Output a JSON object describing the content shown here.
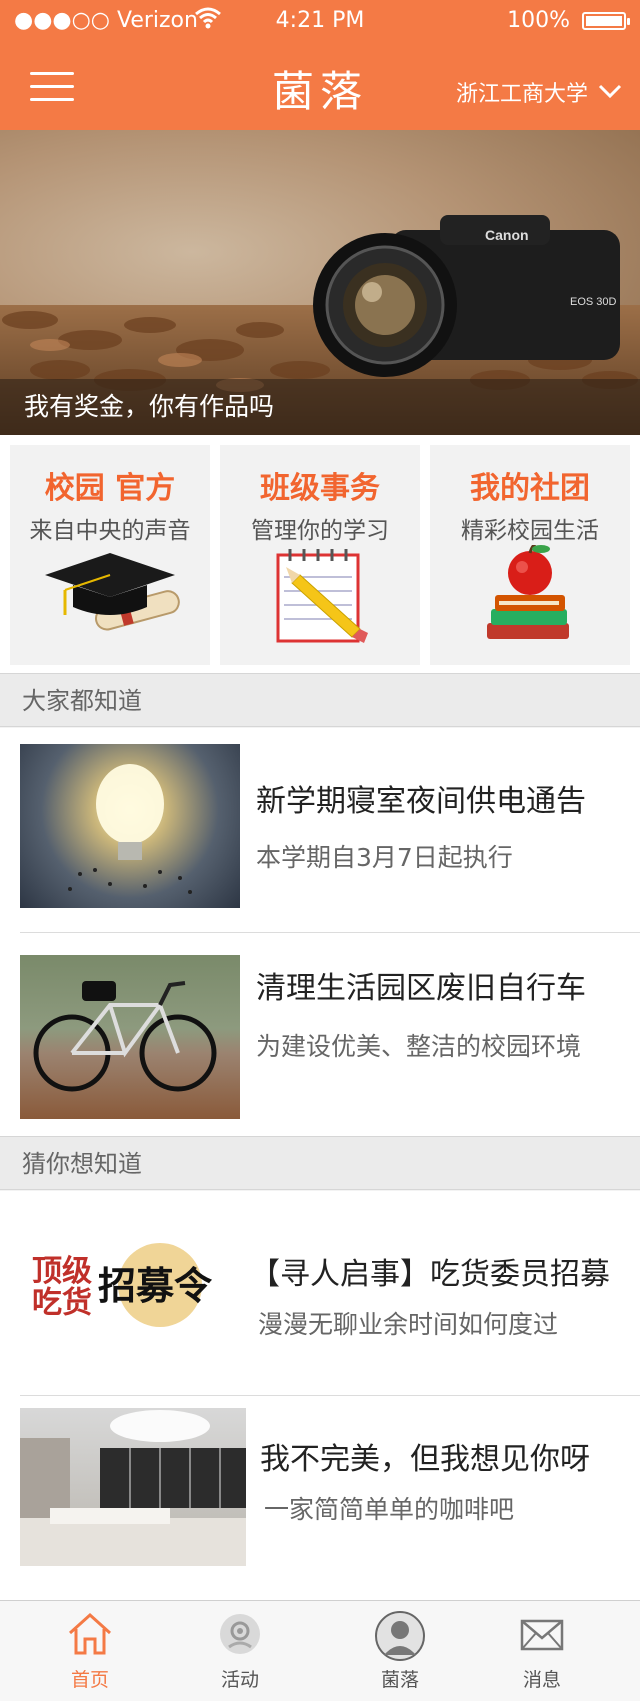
{
  "status_bar": {
    "carrier": "●●●○○ Verizon",
    "time": "4:21 PM",
    "battery": "100%"
  },
  "header": {
    "title": "菌落",
    "school": "浙江工商大学"
  },
  "banner": {
    "caption": "我有奖金，你有作品吗",
    "camera_brand": "Canon",
    "camera_model": "EOS 30D"
  },
  "categories": [
    {
      "title": "校园 官方",
      "subtitle": "来自中央的声音",
      "icon": "graduation-cap-icon"
    },
    {
      "title": "班级事务",
      "subtitle": "管理你的学习",
      "icon": "notepad-pencil-icon"
    },
    {
      "title": "我的社团",
      "subtitle": "精彩校园生活",
      "icon": "apple-books-icon"
    }
  ],
  "section1": {
    "heading": "大家都知道",
    "items": [
      {
        "title": "新学期寝室夜间供电通告",
        "subtitle": "本学期自3月7日起执行"
      },
      {
        "title": "清理生活园区废旧自行车",
        "subtitle": "为建设优美、整洁的校园环境"
      }
    ]
  },
  "section2": {
    "heading": "猜你想知道",
    "items": [
      {
        "title": "【寻人启事】吃货委员招募",
        "subtitle": "漫漫无聊业余时间如何度过",
        "thumb_text": {
          "left": "顶级\n吃货",
          "right": "招募令"
        }
      },
      {
        "title": "我不完美，但我想见你呀",
        "subtitle": "一家简简单单的咖啡吧"
      }
    ]
  },
  "tabbar": [
    {
      "label": "首页",
      "icon": "home-icon",
      "active": true
    },
    {
      "label": "活动",
      "icon": "activity-icon",
      "active": false
    },
    {
      "label": "菌落",
      "icon": "profile-icon",
      "active": false
    },
    {
      "label": "消息",
      "icon": "mail-icon",
      "active": false
    }
  ],
  "colors": {
    "accent": "#f47a45",
    "category_title": "#f2652f"
  }
}
